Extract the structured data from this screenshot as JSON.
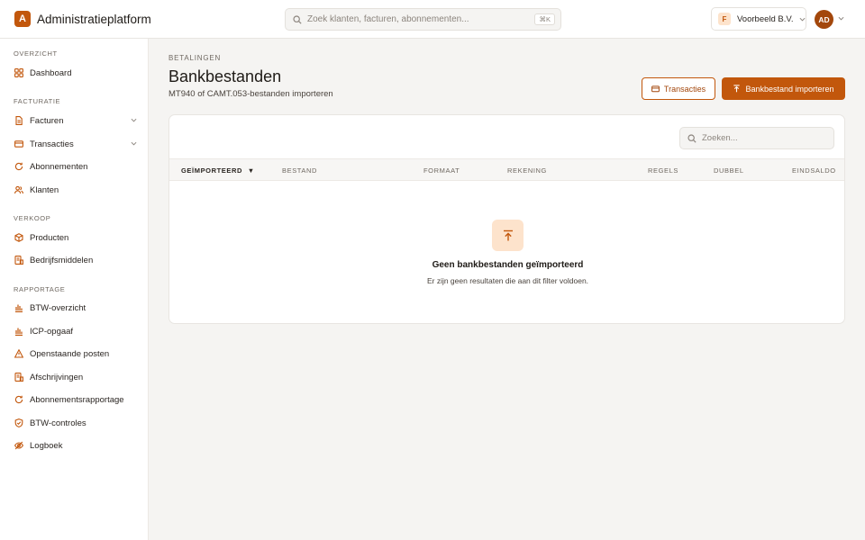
{
  "app": {
    "logo_letter": "A",
    "title": "Administratieplatform"
  },
  "search": {
    "placeholder": "Zoek klanten, facturen, abonnementen...",
    "shortcut": "⌘K"
  },
  "org": {
    "badge": "F",
    "name": "Voorbeeld B.V."
  },
  "user": {
    "initials": "AD"
  },
  "sidebar": {
    "sections": {
      "overzicht": "OVERZICHT",
      "facturatie": "FACTURATIE",
      "verkoop": "VERKOOP",
      "rapportage": "RAPPORTAGE"
    },
    "items": [
      {
        "label": "Dashboard",
        "icon": "grid-icon"
      },
      {
        "label": "Facturen",
        "icon": "document-icon",
        "expandable": true
      },
      {
        "label": "Transacties",
        "icon": "card-icon",
        "expandable": true
      },
      {
        "label": "Abonnementen",
        "icon": "refresh-icon"
      },
      {
        "label": "Klanten",
        "icon": "users-icon"
      },
      {
        "label": "Producten",
        "icon": "box-icon"
      },
      {
        "label": "Bedrijfsmiddelen",
        "icon": "asset-icon"
      },
      {
        "label": "BTW-overzicht",
        "icon": "bar-chart-icon"
      },
      {
        "label": "ICP-opgaaf",
        "icon": "bar-chart-icon"
      },
      {
        "label": "Openstaande posten",
        "icon": "warning-icon"
      },
      {
        "label": "Afschrijvingen",
        "icon": "asset-icon"
      },
      {
        "label": "Abonnementsrapportage",
        "icon": "refresh-icon"
      },
      {
        "label": "BTW-controles",
        "icon": "shield-check-icon"
      },
      {
        "label": "Logboek",
        "icon": "eye-off-icon"
      }
    ]
  },
  "page": {
    "eyebrow": "BETALINGEN",
    "title": "Bankbestanden",
    "subtitle": "MT940 of CAMT.053-bestanden importeren",
    "btn_transactions": "Transacties",
    "btn_import": "Bankbestand importeren"
  },
  "table": {
    "search_placeholder": "Zoeken...",
    "sort_indicator": "▼",
    "columns": [
      "GEÏMPORTEERD",
      "BESTAND",
      "FORMAAT",
      "REKENING",
      "REGELS",
      "DUBBEL",
      "EINDSALDO"
    ],
    "rows": [],
    "empty_title": "Geen bankbestanden geïmporteerd",
    "empty_subtitle": "Er zijn geen resultaten die aan dit filter voldoen."
  },
  "colors": {
    "accent": "#c2570c",
    "accent_light": "#fde3cc",
    "background": "#f5f4f2"
  }
}
